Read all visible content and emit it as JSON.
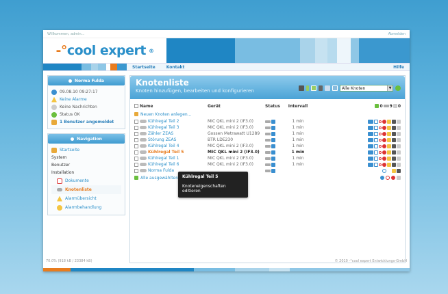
{
  "topbar": {
    "welcome": "Willkommen, admin...",
    "logout": "Abmelden"
  },
  "brand": {
    "logo_prefix": "-°",
    "logo_text": "cool expert",
    "logo_reg": "®"
  },
  "nav": {
    "items": [
      "Startseite",
      "Kontakt"
    ],
    "help": "Hilfe"
  },
  "user_box": {
    "title": "Norma Fulda",
    "lines": [
      {
        "text": "09.08.10 09:27:17",
        "icon": "clock-icon",
        "style": "plain"
      },
      {
        "text": "Keine Alarme",
        "icon": "warning-icon",
        "style": "link"
      },
      {
        "text": "Keine Nachrichten",
        "icon": "info-icon",
        "style": "plain"
      },
      {
        "text": "Status OK",
        "icon": "check-icon",
        "style": "plain"
      },
      {
        "text": "1 Benutzer angemeldet",
        "icon": "user-icon",
        "style": "bold"
      }
    ]
  },
  "nav_box": {
    "title": "Navigation",
    "items": [
      {
        "label": "Startseite",
        "icon": "home-icon",
        "type": "top"
      },
      {
        "label": "System",
        "type": "plain"
      },
      {
        "label": "Benutzer",
        "type": "plain"
      },
      {
        "label": "Installation",
        "type": "plain"
      },
      {
        "label": "Dokumente",
        "icon": "pdf-icon",
        "type": "sub"
      },
      {
        "label": "Knotenliste",
        "icon": "node-icon",
        "type": "active"
      },
      {
        "label": "Alarmübersicht",
        "icon": "warning-icon",
        "type": "sub"
      },
      {
        "label": "Alarmbehandlung",
        "icon": "alarm-handling-icon",
        "type": "sub"
      }
    ]
  },
  "main": {
    "title": "Knotenliste",
    "subtitle": "Knoten hinzufügen, bearbeiten und konfigurieren",
    "filter_value": "Alle Knoten",
    "columns": {
      "name": "Name",
      "device": "Gerät",
      "status": "Status",
      "interval": "Intervall"
    },
    "counts": {
      "ok": "0",
      "net": "9",
      "trash": "0"
    },
    "new_node": "Neuen Knoten anlegen...",
    "rows": [
      {
        "name": "Kühlregal Teil 2",
        "device": "MIC QKL mini 2 (IF3.0)",
        "interval": "1 min",
        "selected": false
      },
      {
        "name": "Kühlregal Teil 3",
        "device": "MIC QKL mini 2 (IF3.0)",
        "interval": "1 min",
        "selected": false
      },
      {
        "name": "Zähler ZEAS",
        "device": "Gossen Metrawatt U1289",
        "interval": "1 min",
        "selected": false
      },
      {
        "name": "Störung ZEAS",
        "device": "BTR LDE230",
        "interval": "1 min",
        "selected": false
      },
      {
        "name": "Kühlregal Teil 4",
        "device": "MIC QKL mini 2 (IF3.0)",
        "interval": "1 min",
        "selected": false
      },
      {
        "name": "Kühlregal Teil 5",
        "device": "MIC QKL mini 2 (IF3.0)",
        "interval": "1 min",
        "selected": true
      },
      {
        "name": "Kühlregal Teil 1",
        "device": "MIC QKL mini 2 (IF3.0)",
        "interval": "1 min",
        "selected": false
      },
      {
        "name": "Kühlregal Teil 6",
        "device": "MIC QKL mini 2 (IF3.0)",
        "interval": "1 min",
        "selected": false
      },
      {
        "name": "Norma Fulda",
        "device": "",
        "interval": "",
        "selected": false
      }
    ],
    "all_selected": "Alle ausgewählten Knoten...",
    "tooltip": {
      "title": "Kühlregal Teil 5",
      "text": "Knoteneigenschaften editieren"
    }
  },
  "status": {
    "left": "70.0% (918 kB / 23384 kB)",
    "right": "© 2010 -°cool expert Entwicklungs-GmbH"
  },
  "colors": {
    "blue": "#2a8fc9",
    "orange": "#e87c1e",
    "header_blue": "#4aa3d6"
  }
}
